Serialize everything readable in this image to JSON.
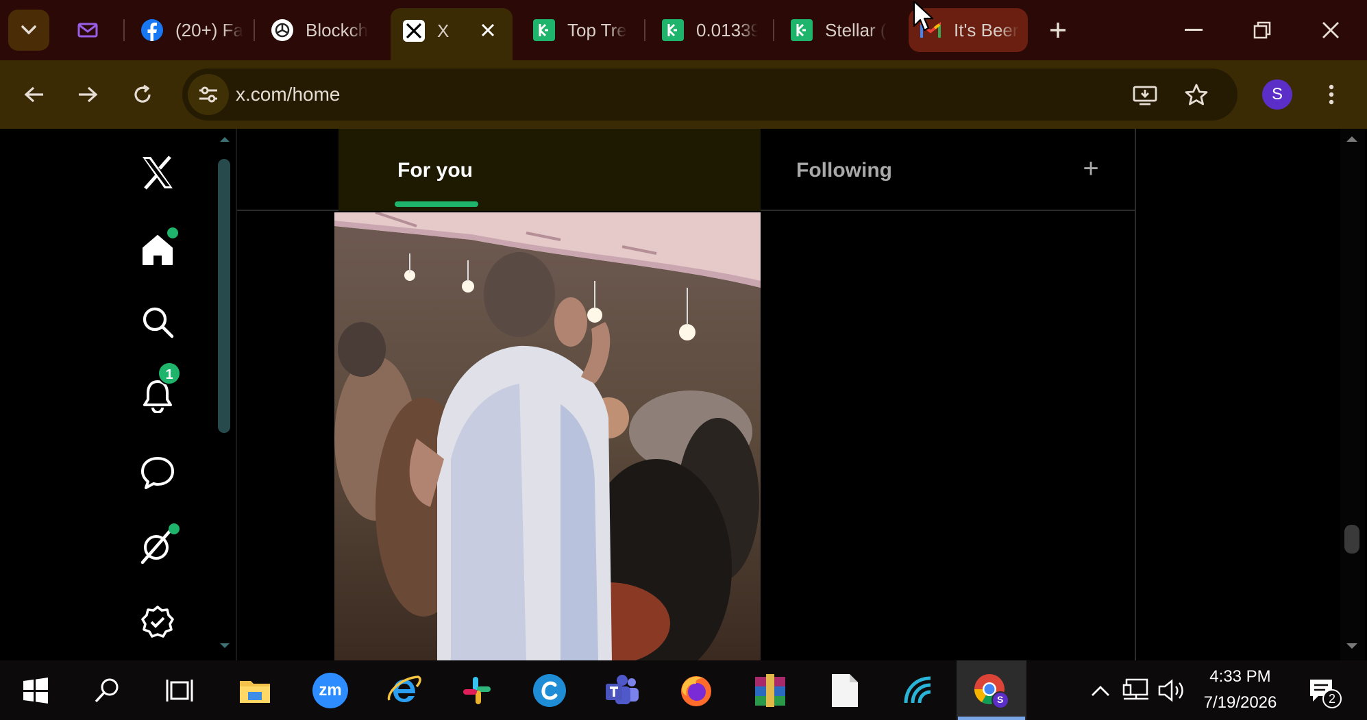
{
  "browser": {
    "tabs": [
      {
        "title": "",
        "icon": "mail-icon"
      },
      {
        "title": "(20+) Fa",
        "icon": "facebook-icon"
      },
      {
        "title": "Blockch",
        "icon": "openai-icon"
      },
      {
        "title": "X",
        "icon": "x-logo-icon",
        "active": true
      },
      {
        "title": "Top Tre",
        "icon": "kucoin-icon"
      },
      {
        "title": "0.01339",
        "icon": "kucoin-icon"
      },
      {
        "title": "Stellar (",
        "icon": "kucoin-icon"
      },
      {
        "title": "It's Beer",
        "icon": "gmail-icon"
      }
    ],
    "url": "x.com/home",
    "profile_initial": "S"
  },
  "x": {
    "tabs": {
      "for_you": "For you",
      "following": "Following",
      "add": "+"
    },
    "badges": {
      "notifications": "1"
    }
  },
  "taskbar": {
    "time": "4:33 PM",
    "date": "7/19/2026",
    "zoom_label": "zm",
    "notifications_count": "2",
    "chrome_profile": "S"
  },
  "colors": {
    "accent": "#1fb46b",
    "tabstrip": "#2a0906",
    "toolbar": "#3a2b04"
  }
}
